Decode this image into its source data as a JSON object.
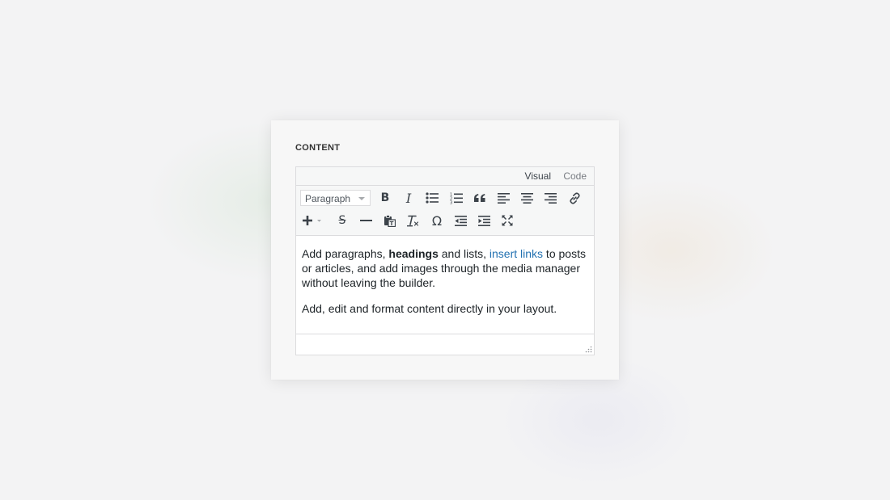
{
  "panel": {
    "label": "CONTENT"
  },
  "editor": {
    "tabs": {
      "visual": "Visual",
      "code": "Code"
    },
    "toolbar": {
      "format_select": "Paragraph",
      "row1_icons": [
        "bold-icon",
        "italic-icon",
        "bulleted-list-icon",
        "numbered-list-icon",
        "blockquote-icon",
        "align-left-icon",
        "align-center-icon",
        "align-right-icon",
        "link-icon"
      ],
      "row2_icons": [
        "add-icon",
        "strikethrough-icon",
        "horizontal-line-icon",
        "paste-as-text-icon",
        "clear-formatting-icon",
        "special-character-icon",
        "outdent-icon",
        "indent-icon",
        "fullscreen-icon"
      ],
      "bold_glyph": "B",
      "italic_glyph": "I",
      "strike_glyph": "S",
      "omega_glyph": "Ω"
    },
    "content": {
      "p1_a": "Add paragraphs, ",
      "p1_bold": "headings",
      "p1_b": " and lists, ",
      "p1_link": "insert links",
      "p1_c": " to posts or articles, and add images through the media manager without leaving the builder.",
      "p2": "Add, edit and format content directly in your layout."
    }
  },
  "colors": {
    "link": "#2271b1",
    "text": "#1d2327",
    "icon": "#3c434a",
    "border": "#dcdcde"
  }
}
